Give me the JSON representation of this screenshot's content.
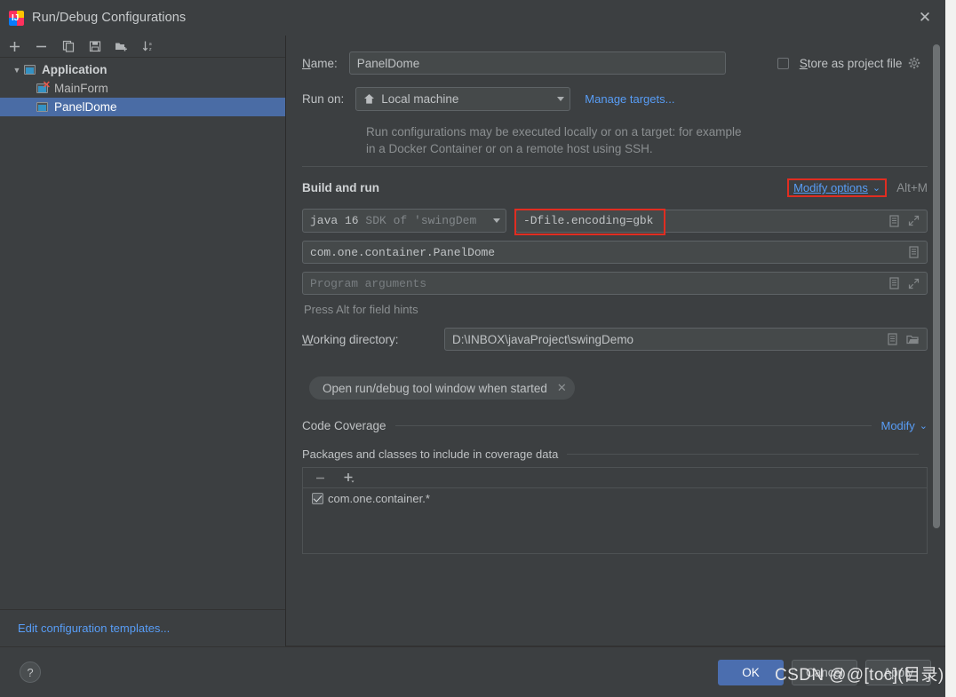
{
  "window": {
    "title": "Run/Debug Configurations",
    "app_icon": "intellij-idea-icon",
    "close_icon": "close-icon"
  },
  "sidebar": {
    "toolbar": [
      {
        "name": "add-configuration-button",
        "icon": "plus-icon"
      },
      {
        "name": "remove-configuration-button",
        "icon": "minus-icon"
      },
      {
        "name": "copy-configuration-button",
        "icon": "copy-icon"
      },
      {
        "name": "save-configuration-button",
        "icon": "save-icon"
      },
      {
        "name": "move-to-folder-button",
        "icon": "folder-add-icon"
      },
      {
        "name": "sort-configurations-button",
        "icon": "sort-alpha-icon"
      }
    ],
    "tree": [
      {
        "label": "Application",
        "level": 0,
        "expanded": true,
        "selected": false,
        "error": false
      },
      {
        "label": "MainForm",
        "level": 1,
        "expanded": false,
        "selected": false,
        "error": true
      },
      {
        "label": "PanelDome",
        "level": 1,
        "expanded": false,
        "selected": true,
        "error": false
      }
    ],
    "footer_link": "Edit configuration templates..."
  },
  "form": {
    "name_label": "Name:",
    "name_value": "PanelDome",
    "store_as_project_file_label": "Store as project file",
    "store_as_project_file_checked": false,
    "store_gear_icon": "gear-icon",
    "run_on_label": "Run on:",
    "run_on_value": "Local machine",
    "run_on_icon": "home-icon",
    "manage_targets_link": "Manage targets...",
    "target_hint": "Run configurations may be executed locally or on a target: for example in a Docker Container or on a remote host using SSH.",
    "build_and_run": {
      "section_title": "Build and run",
      "modify_options_link": "Modify options",
      "modify_options_shortcut": "Alt+M",
      "jdk_value": "java 16",
      "jdk_suffix": "SDK of 'swingDem",
      "vm_options_value": "-Dfile.encoding=gbk",
      "main_class_value": "com.one.container.PanelDome",
      "program_arguments_placeholder": "Program arguments",
      "field_hints": "Press Alt for field hints",
      "working_directory_label": "Working directory:",
      "working_directory_value": "D:\\INBOX\\javaProject\\swingDemo",
      "chip_label": "Open run/debug tool window when started",
      "chip_remove_icon": "close-icon",
      "expand_icon": "expand-icon",
      "list_icon": "document-list-icon",
      "browse_icon": "folder-open-icon"
    },
    "code_coverage": {
      "section_title": "Code Coverage",
      "modify_link": "Modify",
      "sub_title": "Packages and classes to include in coverage data",
      "toolbar": [
        {
          "name": "remove-package-button",
          "icon": "minus-icon"
        },
        {
          "name": "add-package-button",
          "icon": "plus-dropdown-icon"
        }
      ],
      "items": [
        {
          "label": "com.one.container.*",
          "checked": true
        }
      ]
    }
  },
  "footer": {
    "help_label": "?",
    "ok_label": "OK",
    "cancel_label": "Cancel",
    "apply_label": "Apply",
    "watermark": "CSDN @@[toc](目录)"
  },
  "colors": {
    "background": "#3c3f41",
    "selection_blue": "#4a6ca5",
    "link_blue": "#589df6",
    "highlight_red": "#e02d21",
    "primary_button": "#4b6eaf",
    "error_red": "#e8564a"
  }
}
